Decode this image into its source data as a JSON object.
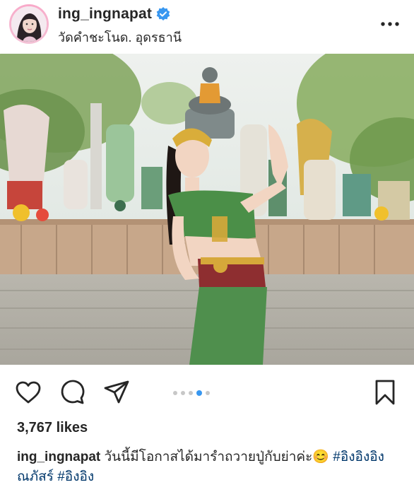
{
  "post": {
    "username": "ing_ingnapat",
    "location": "วัดคำชะโนด. อุดรธานี",
    "verified": true
  },
  "photo": {
    "description_icon": "post-photo"
  },
  "actions": {
    "icons": [
      "heart-icon",
      "comment-icon",
      "share-icon",
      "bookmark-icon"
    ],
    "carousel_count": 5,
    "carousel_active": 4
  },
  "likes": {
    "text": "3,767 likes"
  },
  "caption": {
    "username": "ing_ingnapat",
    "text": "วันนี้มีโอกาสได้มารำถวายปู่กับย่าค่ะ😊",
    "hashtag1": "#อิงอิงอิงณภัสร์",
    "hashtag2": "#อิงอิง"
  },
  "colors": {
    "verified_blue": "#3897f0",
    "hashtag": "#00376b",
    "carousel_active": "#3897f0"
  }
}
